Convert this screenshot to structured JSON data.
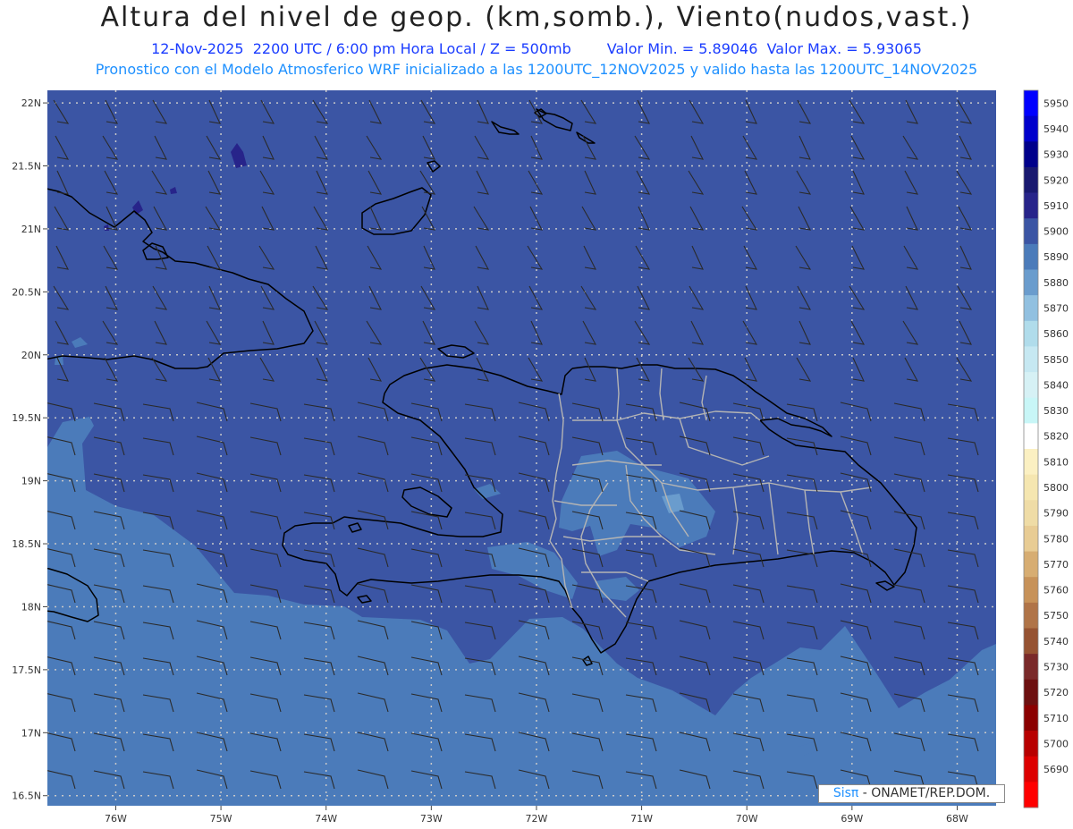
{
  "header": {
    "title": "Altura del nivel de geop. (km,somb.), Viento(nudos,vast.)",
    "date_time": "12-Nov-2025  2200 UTC / 6:00 pm Hora Local / Z = 500mb",
    "min_max": "Valor Min. = 5.89046  Valor Max. = 5.93065",
    "forecast": "Pronostico con el Modelo Atmosferico WRF inicializado a las 1200UTC_12NOV2025 y valido hasta las  1200UTC_14NOV2025"
  },
  "axes": {
    "lat_labels": [
      "22N",
      "21.5N",
      "21N",
      "20.5N",
      "20N",
      "19.5N",
      "19N",
      "18.5N",
      "18N",
      "17.5N",
      "17N",
      "16.5N"
    ],
    "lat_values": [
      22,
      21.5,
      21,
      20.5,
      20,
      19.5,
      19,
      18.5,
      18,
      17.5,
      17,
      16.5
    ],
    "lon_labels": [
      "76W",
      "75W",
      "74W",
      "73W",
      "72W",
      "71W",
      "70W",
      "69W",
      "68W"
    ],
    "lon_values": [
      -76,
      -75,
      -74,
      -73,
      -72,
      -71,
      -70,
      -69,
      -68
    ],
    "lon_range": [
      -76.65,
      -67.63
    ],
    "lat_range": [
      16.42,
      22.1
    ]
  },
  "colorbar": {
    "labels": [
      "5950",
      "5940",
      "5930",
      "5920",
      "5910",
      "5900",
      "5890",
      "5880",
      "5870",
      "5860",
      "5850",
      "5840",
      "5830",
      "5820",
      "5810",
      "5800",
      "5790",
      "5780",
      "5770",
      "5760",
      "5750",
      "5740",
      "5730",
      "5720",
      "5710",
      "5700",
      "5690"
    ],
    "colors": [
      "#0000ff",
      "#0000cc",
      "#00008b",
      "#191970",
      "#27248a",
      "#3b55a4",
      "#4b7bba",
      "#6a9ccd",
      "#91c0e0",
      "#b0dceb",
      "#c6e8f2",
      "#d6f1f5",
      "#c8f6f7",
      "#ffffff",
      "#fbf0c2",
      "#f5e6b0",
      "#efdca6",
      "#e8cc94",
      "#d7ad72",
      "#c79259",
      "#b07448",
      "#965332",
      "#7a2a2a",
      "#6d1010",
      "#8b0000",
      "#b80000",
      "#dd0000",
      "#ff0000"
    ],
    "level_colors": {
      "5900": "#3b55a4",
      "5890": "#4b7bba",
      "5880": "#6a9ccd",
      "5910": "#27248a"
    }
  },
  "colors": {
    "background_level": "#3b55a4",
    "south_level": "#4b7bba",
    "inner_level": "#6a9ccd",
    "grid": "#c8c8c8",
    "border_national": "#000000",
    "border_provincial": "#b4b4b4"
  },
  "footer": {
    "brand": "Sisπ",
    "org": "- ONAMET/REP.DOM."
  }
}
